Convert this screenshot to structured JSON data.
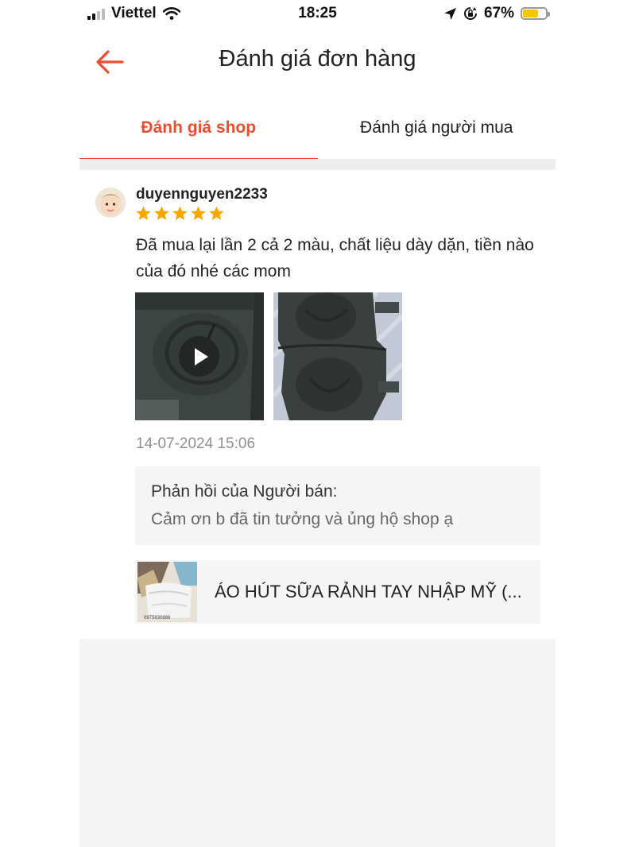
{
  "status_bar": {
    "carrier": "Viettel",
    "time": "18:25",
    "battery": "67%",
    "battery_level": 0.67,
    "icons": [
      "signal-icon",
      "wifi-icon",
      "location-icon",
      "orientation-lock-icon",
      "battery-icon"
    ]
  },
  "header": {
    "title": "Đánh giá đơn hàng",
    "back_icon": "back-arrow-icon"
  },
  "tabs": [
    {
      "label": "Đánh giá shop",
      "active": true
    },
    {
      "label": "Đánh giá người mua",
      "active": false
    }
  ],
  "review": {
    "username": "duyennguyen2233",
    "rating": 5,
    "max_rating": 5,
    "comment": "Đã mua lại lần 2 cả 2 màu, chất liệu dày dặn, tiền nào của đó nhé các mom",
    "media": [
      {
        "type": "video",
        "icon": "play-icon"
      },
      {
        "type": "image"
      }
    ],
    "date": "14-07-2024 15:06",
    "seller_reply": {
      "title": "Phản hồi của Người bán:",
      "text": "Cảm ơn b đã tin tưởng và ủng hộ shop ạ"
    },
    "product": {
      "name": "ÁO HÚT SỮA RẢNH TAY NHẬP MỸ (...",
      "image_caption": "0975630866"
    }
  },
  "colors": {
    "accent": "#ee4d2d",
    "star": "#f6a700",
    "muted": "#8f8f8f",
    "panel": "#f5f5f5"
  }
}
